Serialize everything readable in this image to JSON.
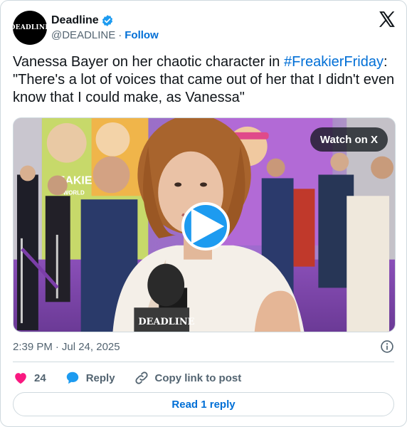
{
  "author": {
    "display_name": "Deadline",
    "handle": "@DEADLINE",
    "separator": "·",
    "follow_label": "Follow",
    "avatar_text": "DEADLINE"
  },
  "tweet": {
    "text_before": "Vanessa Bayer on her chaotic character in ",
    "hashtag": "#FreakierFriday",
    "text_after": ": \"There's a lot of voices that came out of her that I didn't even know that I could make, as Vanessa\""
  },
  "media": {
    "watch_label": "Watch on X",
    "poster_text": "EAKIE",
    "poster_subtext": "WORLD",
    "mic_label": "DEADLINE"
  },
  "meta": {
    "time": "2:39 PM",
    "separator": "·",
    "date": "Jul 24, 2025"
  },
  "actions": {
    "like_count": "24",
    "reply_label": "Reply",
    "copy_label": "Copy link to post"
  },
  "read_replies_label": "Read 1 reply",
  "colors": {
    "accent": "#006fd6",
    "play": "#1d9bf0",
    "like": "#f91880",
    "verified": "#1d9bf0"
  }
}
